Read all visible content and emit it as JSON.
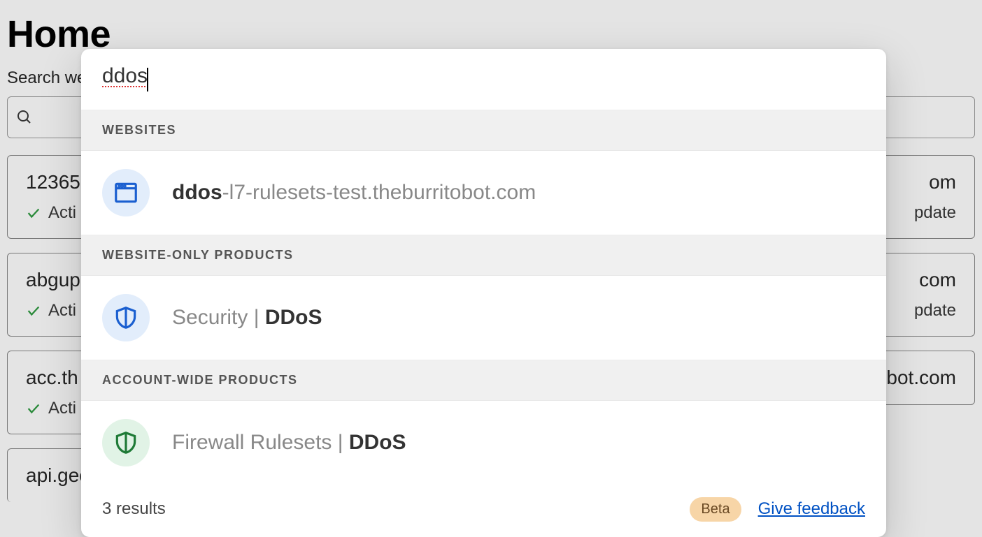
{
  "page": {
    "title": "Home",
    "search_label": "Search we"
  },
  "bg_left": [
    {
      "name": "12365",
      "status": "Acti"
    },
    {
      "name": "abgup",
      "status": "Acti"
    },
    {
      "name": "acc.th",
      "status": "Acti"
    },
    {
      "name": "api.george-sun.com",
      "status": ""
    }
  ],
  "bg_right": [
    {
      "name": "om",
      "sub": "pdate"
    },
    {
      "name": "com",
      "sub": "pdate"
    },
    {
      "name": "arun.theburritobot.com",
      "sub": ""
    }
  ],
  "modal": {
    "query": "ddos",
    "sections": {
      "websites": "WEBSITES",
      "website_only": "WEBSITE-ONLY PRODUCTS",
      "account_wide": "ACCOUNT-WIDE PRODUCTS"
    },
    "results": {
      "website": {
        "bold": "ddos",
        "rest": "-l7-rulesets-test.theburritobot.com"
      },
      "security": {
        "prefix": "Security | ",
        "bold": "DDoS"
      },
      "firewall": {
        "prefix": "Firewall Rulesets | ",
        "bold": "DDoS"
      }
    },
    "footer": {
      "count": "3 results",
      "beta": "Beta",
      "feedback": "Give feedback"
    }
  }
}
